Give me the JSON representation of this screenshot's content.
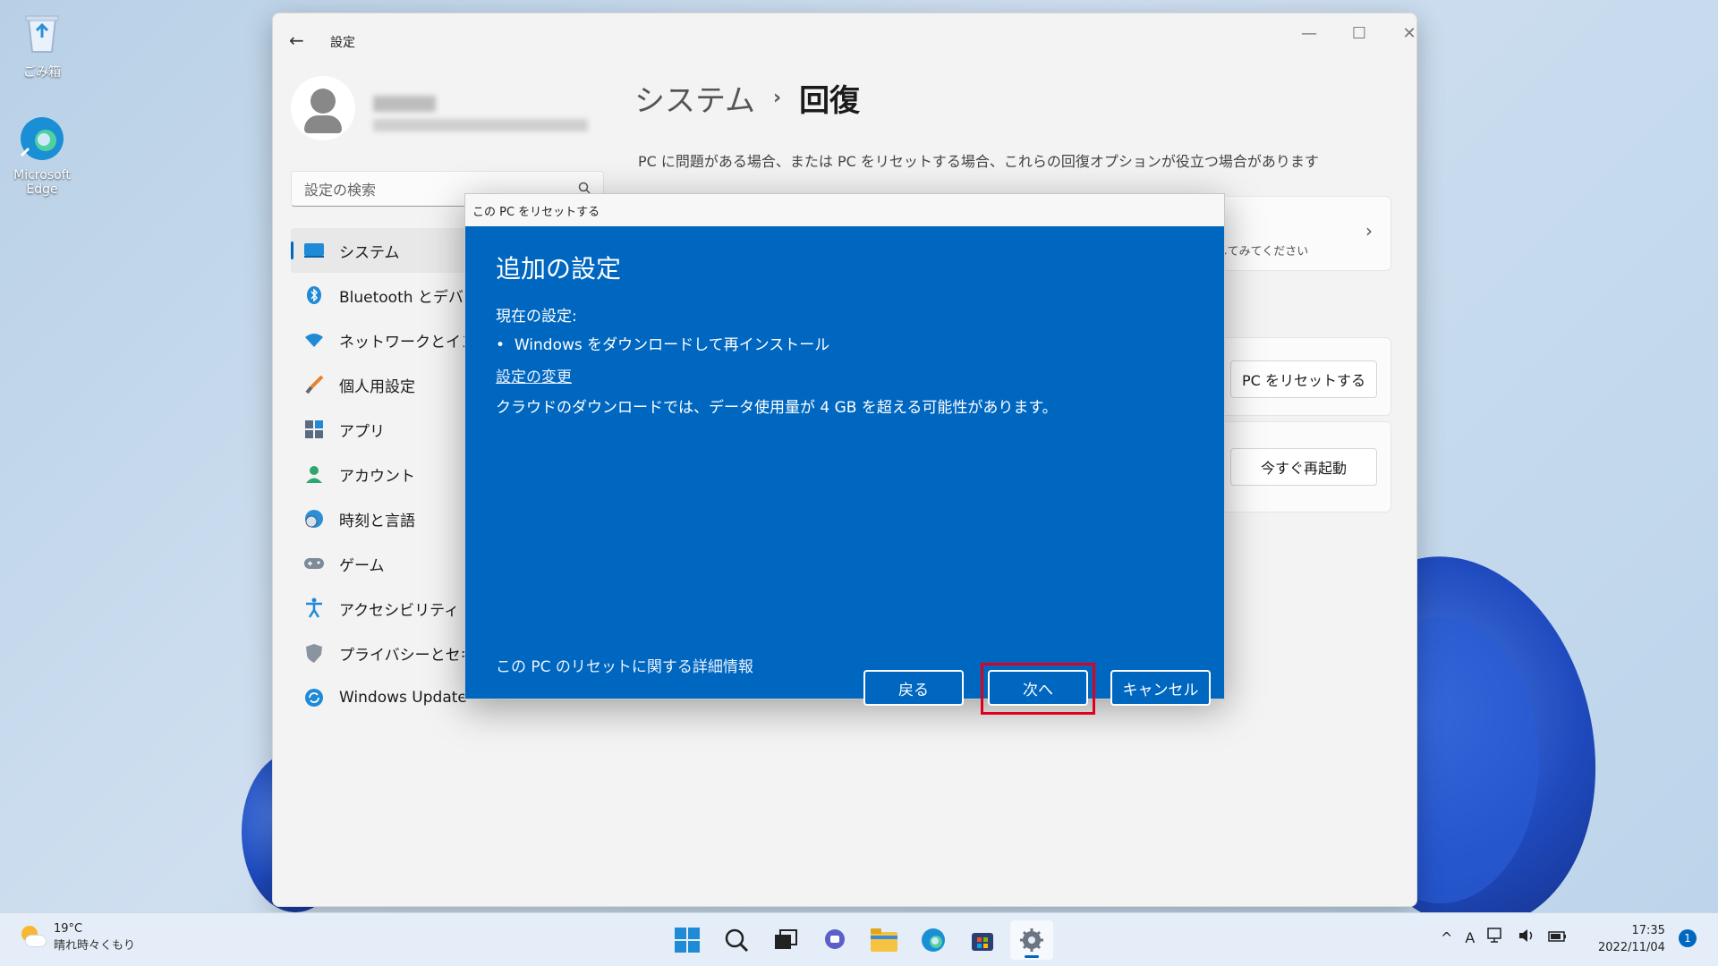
{
  "desktop": {
    "icons": [
      {
        "label": "ごみ箱"
      },
      {
        "label": "Microsoft Edge"
      }
    ]
  },
  "window": {
    "title": "設定",
    "controls": {
      "minimize": "—",
      "maximize": "☐",
      "close": "✕"
    }
  },
  "sidebar": {
    "search_placeholder": "設定の検索",
    "items": [
      {
        "label": "システム",
        "icon": "monitor-icon",
        "active": true
      },
      {
        "label": "Bluetooth とデバイス",
        "icon": "bluetooth-icon"
      },
      {
        "label": "ネットワークとインター",
        "icon": "wifi-icon"
      },
      {
        "label": "個人用設定",
        "icon": "brush-icon"
      },
      {
        "label": "アプリ",
        "icon": "apps-icon"
      },
      {
        "label": "アカウント",
        "icon": "person-icon"
      },
      {
        "label": "時刻と言語",
        "icon": "globe-clock-icon"
      },
      {
        "label": "ゲーム",
        "icon": "gamepad-icon"
      },
      {
        "label": "アクセシビリティ",
        "icon": "accessibility-icon"
      },
      {
        "label": "プライバシーとセキュリ",
        "icon": "shield-icon"
      },
      {
        "label": "Windows Update",
        "icon": "update-icon"
      }
    ]
  },
  "main": {
    "breadcrumb_parent": "システム",
    "breadcrumb_current": "回復",
    "subtitle": "PC に問題がある場合、または PC をリセットする場合、これらの回復オプションが役立つ場合があります",
    "card1_hint": "決してみてください",
    "reset_button": "PC をリセットする",
    "restart_button": "今すぐ再起動"
  },
  "dialog": {
    "title": "この PC をリセットする",
    "heading": "追加の設定",
    "current_label": "現在の設定:",
    "bullet": "Windows をダウンロードして再インストール",
    "change_link": "設定の変更",
    "note": "クラウドのダウンロードでは、データ使用量が 4 GB を超える可能性があります。",
    "more_info": "この PC のリセットに関する詳細情報",
    "back_button": "戻る",
    "next_button": "次へ",
    "cancel_button": "キャンセル"
  },
  "taskbar": {
    "temperature": "19°C",
    "weather": "晴れ時々くもり",
    "time": "17:35",
    "date": "2022/11/04",
    "ime": "A",
    "notification_count": "1"
  },
  "colors": {
    "accent": "#0067c0",
    "highlight": "#e0001b"
  }
}
